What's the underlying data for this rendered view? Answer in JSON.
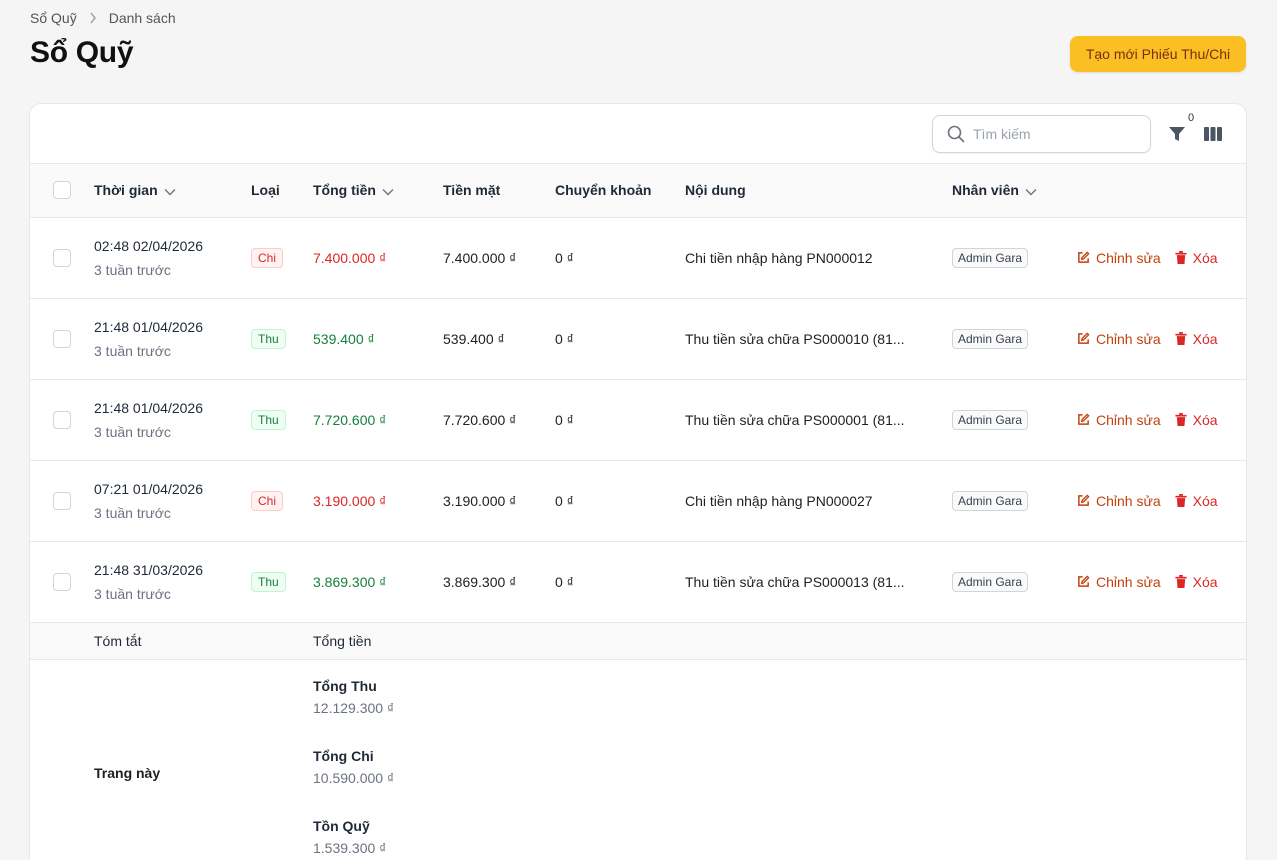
{
  "breadcrumb": {
    "root": "Sổ Quỹ",
    "current": "Danh sách"
  },
  "page": {
    "title": "Sổ Quỹ",
    "create_label": "Tạo mới Phiếu Thu/Chi"
  },
  "toolbar": {
    "search_placeholder": "Tìm kiếm",
    "filter_count": "0"
  },
  "table": {
    "columns": {
      "time": "Thời gian",
      "type": "Loại",
      "total": "Tổng tiền",
      "cash": "Tiền mặt",
      "transfer": "Chuyển khoản",
      "content": "Nội dung",
      "staff": "Nhân viên"
    },
    "edit_label": "Chỉnh sửa",
    "delete_label": "Xóa",
    "rows": [
      {
        "time": "02:48 02/04/2026",
        "relative": "3 tuần trước",
        "type": "Chi",
        "total": "7.400.000 ₫",
        "cash": "7.400.000 ₫",
        "transfer": "0 ₫",
        "content": "Chi tiền nhập hàng PN000012",
        "staff": "Admin Gara"
      },
      {
        "time": "21:48 01/04/2026",
        "relative": "3 tuần trước",
        "type": "Thu",
        "total": "539.400 ₫",
        "cash": "539.400 ₫",
        "transfer": "0 ₫",
        "content": "Thu tiền sửa chữa PS000010 (81...",
        "staff": "Admin Gara"
      },
      {
        "time": "21:48 01/04/2026",
        "relative": "3 tuần trước",
        "type": "Thu",
        "total": "7.720.600 ₫",
        "cash": "7.720.600 ₫",
        "transfer": "0 ₫",
        "content": "Thu tiền sửa chữa PS000001 (81...",
        "staff": "Admin Gara"
      },
      {
        "time": "07:21 01/04/2026",
        "relative": "3 tuần trước",
        "type": "Chi",
        "total": "3.190.000 ₫",
        "cash": "3.190.000 ₫",
        "transfer": "0 ₫",
        "content": "Chi tiền nhập hàng PN000027",
        "staff": "Admin Gara"
      },
      {
        "time": "21:48 31/03/2026",
        "relative": "3 tuần trước",
        "type": "Thu",
        "total": "3.869.300 ₫",
        "cash": "3.869.300 ₫",
        "transfer": "0 ₫",
        "content": "Thu tiền sửa chữa PS000013 (81...",
        "staff": "Admin Gara"
      }
    ]
  },
  "summary": {
    "header_label": "Tóm tắt",
    "header_total": "Tổng tiền",
    "scope_label": "Trang này",
    "total_thu_label": "Tổng Thu",
    "total_thu_value": "12.129.300 ₫",
    "total_chi_label": "Tổng Chi",
    "total_chi_value": "10.590.000 ₫",
    "balance_label": "Tồn Quỹ",
    "balance_value": "1.539.300 ₫"
  },
  "colors": {
    "accent": "#fbbf24",
    "chi": "#dc2626",
    "thu": "#15803d",
    "edit": "#c2410c"
  }
}
